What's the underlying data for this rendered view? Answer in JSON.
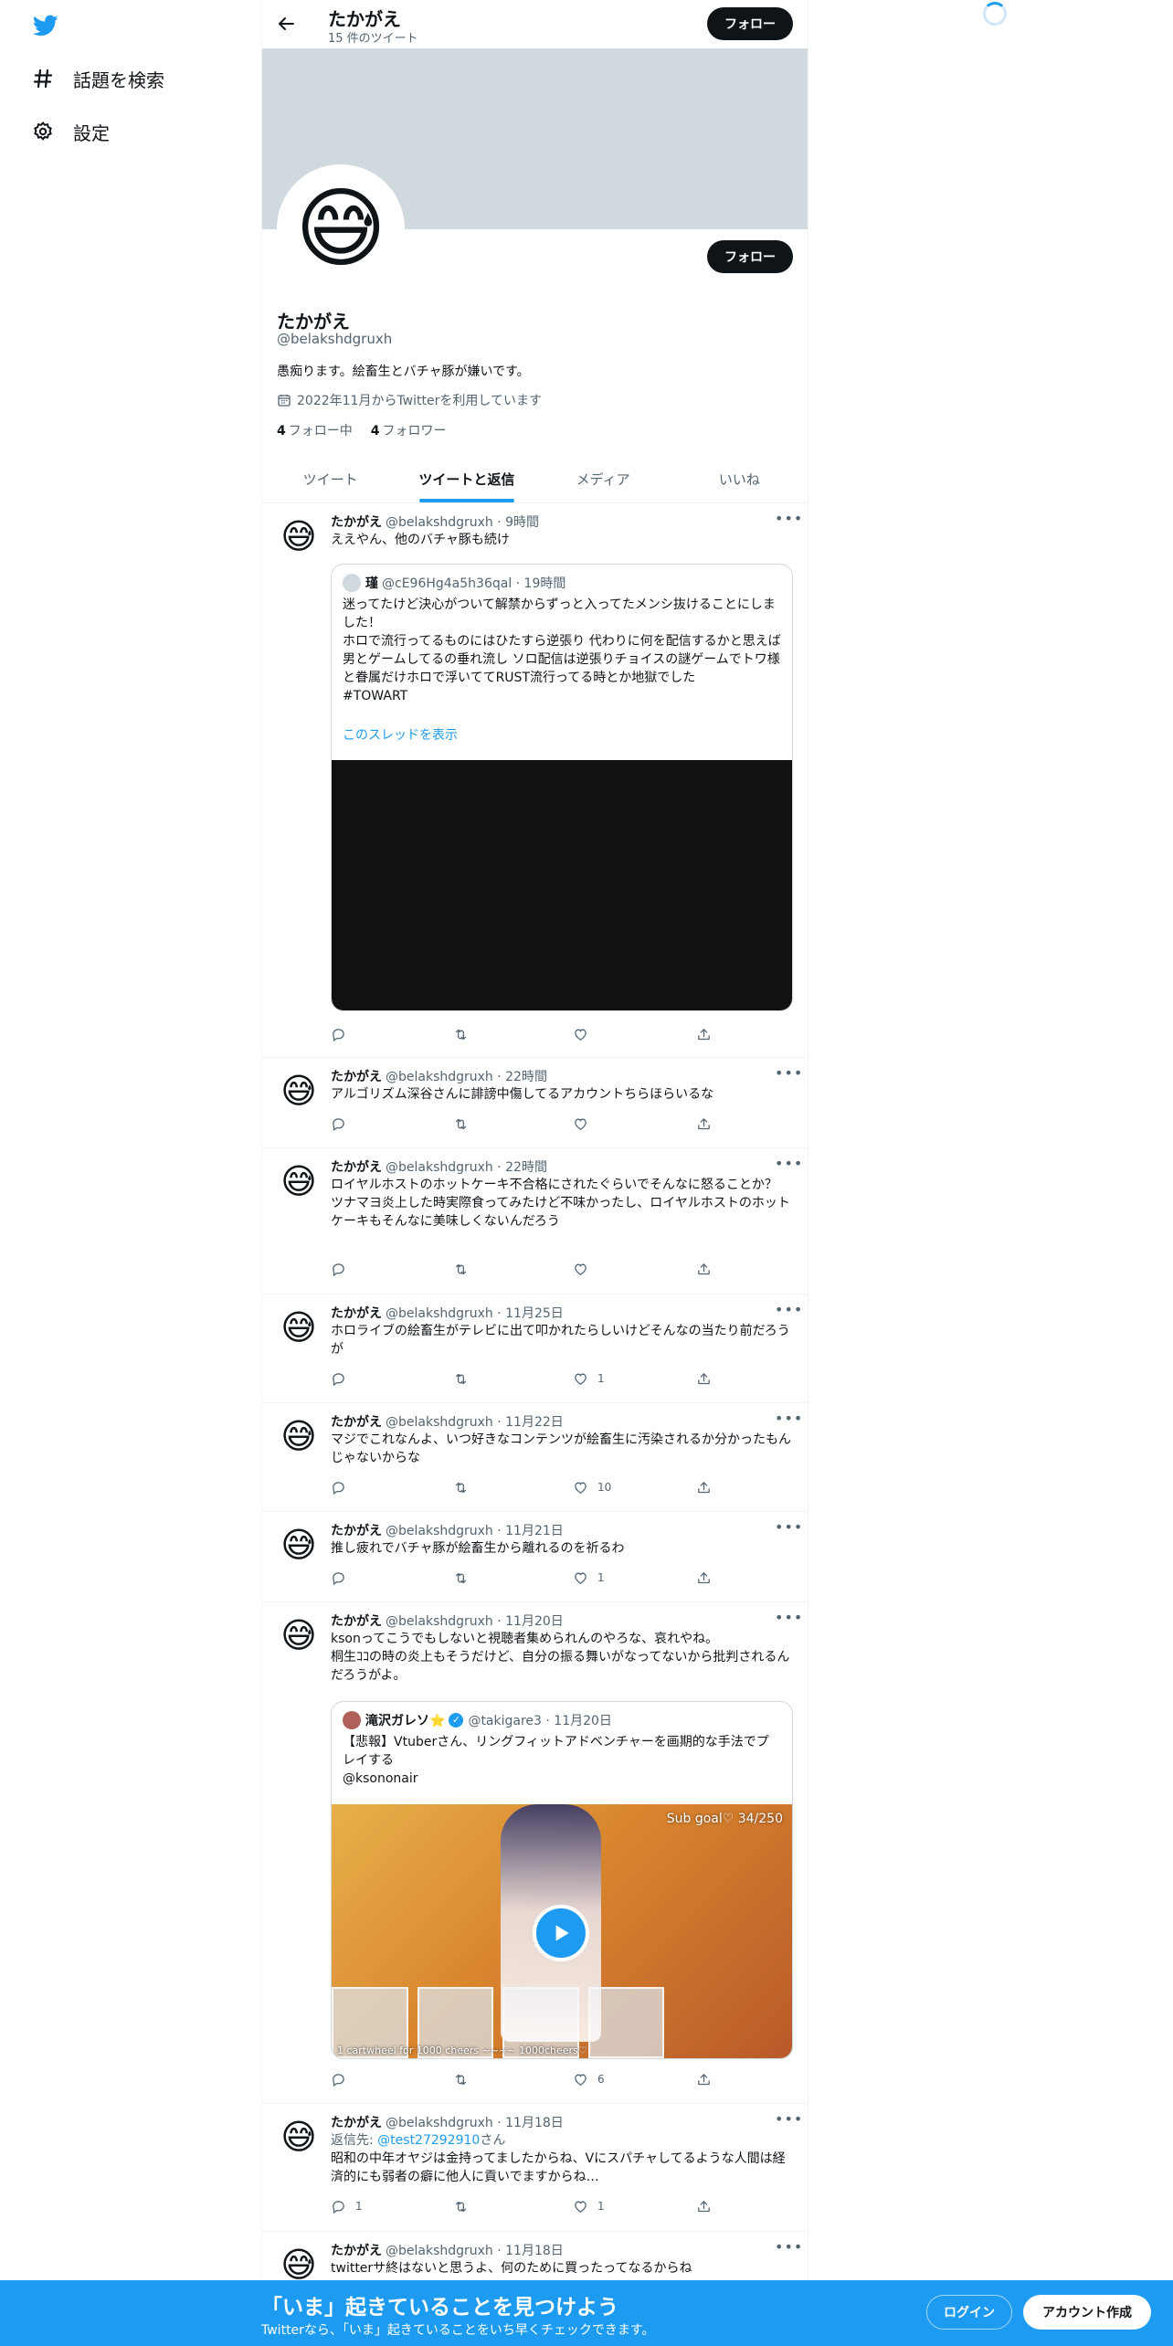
{
  "nav": {
    "explore_label": "話題を検索",
    "settings_label": "設定"
  },
  "header": {
    "name": "たかがえ",
    "tweet_count": "15 件のツイート",
    "follow_label": "フォロー"
  },
  "profile": {
    "avatar_emoji": "😅",
    "name": "たかがえ",
    "handle": "@belakshdgruxh",
    "bio": "愚痴ります。絵畜生とバチャ豚が嫌いです。",
    "joined": "2022年11月からTwitterを利用しています",
    "following_count": "4",
    "following_label": "フォロー中",
    "followers_count": "4",
    "followers_label": "フォロワー",
    "follow_label": "フォロー"
  },
  "tabs": [
    "ツイート",
    "ツイートと返信",
    "メディア",
    "いいね"
  ],
  "tweets": [
    {
      "name": "たかがえ",
      "meta": "@belakshdgruxh · 9時間",
      "text": "ええやん、他のバチャ豚も続け",
      "quote": {
        "name": "瑾",
        "meta": "@cE96Hg4a5h36qal · 19時間",
        "text": "迷ってたけど決心がついて解禁からずっと入ってたメンシ抜けることにしました！\nホロで流行ってるものにはひたすら逆張り 代わりに何を配信するかと思えば男とゲームしてるの垂れ流し ソロ配信は逆張りチョイスの謎ゲームでトワ様と眷属だけホロで浮いててRUST流行ってる時とか地獄でした\n#TOWART",
        "link": "このスレッドを表示"
      },
      "likes": ""
    },
    {
      "name": "たかがえ",
      "meta": "@belakshdgruxh · 22時間",
      "text": "アルゴリズム深谷さんに誹謗中傷してるアカウントちらほらいるな",
      "likes": ""
    },
    {
      "name": "たかがえ",
      "meta": "@belakshdgruxh · 22時間",
      "text": "ロイヤルホストのホットケーキ不合格にされたぐらいでそんなに怒ることか？\nツナマヨ炎上した時実際食ってみたけど不味かったし、ロイヤルホストのホットケーキもそんなに美味しくないんだろう",
      "likes": ""
    },
    {
      "name": "たかがえ",
      "meta": "@belakshdgruxh · 11月25日",
      "text": "ホロライブの絵畜生がテレビに出て叩かれたらしいけどそんなの当たり前だろうが",
      "likes": "1"
    },
    {
      "name": "たかがえ",
      "meta": "@belakshdgruxh · 11月22日",
      "text": "マジでこれなんよ、いつ好きなコンテンツが絵畜生に汚染されるか分かったもんじゃないからな",
      "likes": "10"
    },
    {
      "name": "たかがえ",
      "meta": "@belakshdgruxh · 11月21日",
      "text": "推し疲れでバチャ豚が絵畜生から離れるのを祈るわ",
      "likes": "1"
    },
    {
      "name": "たかがえ",
      "meta": "@belakshdgruxh · 11月20日",
      "text": "ksonってこうでもしないと視聴者集められんのやろな、哀れやね。\n桐生ｺｺの時の炎上もそうだけど、自分の振る舞いがなってないから批判されるんだろうがよ。",
      "quote": {
        "name": "滝沢ガレソ⭐",
        "meta": "@takigare3 · 11月20日",
        "text": "【悲報】Vtuberさん、リングフィットアドベンチャーを画期的な手法でプレイする\n@ksononair",
        "media_overlay_top": "Sub goal♡ 34/250",
        "media_overlay_bottom": "1 cartwheel for 1000 cheers ~~~~ 1000cheers♡"
      },
      "likes": "6"
    },
    {
      "name": "たかがえ",
      "meta": "@belakshdgruxh · 11月18日",
      "reply_prefix": "返信先: ",
      "reply_to": "@test27292910",
      "reply_suffix": "さん",
      "text": "昭和の中年オヤジは金持ってましたからね、Vにスパチャしてるような人間は経済的にも弱者の癖に他人に貢いでますからね…",
      "replies": "1",
      "likes": "1"
    },
    {
      "name": "たかがえ",
      "meta": "@belakshdgruxh · 11月18日",
      "text": "twitterサ終はないと思うよ、何のために買ったってなるからね",
      "likes": ""
    }
  ],
  "bottom_banner": {
    "title": "「いま」起きていることを見つけよう",
    "subtitle": "Twitterなら、「いま」起きていることをいち早くチェックできます。",
    "login_label": "ログイン",
    "signup_label": "アカウント作成"
  },
  "colors": {
    "accent": "#1d9bf0",
    "text": "#0f1419",
    "muted": "#536471",
    "banner": "#cfd9de"
  }
}
